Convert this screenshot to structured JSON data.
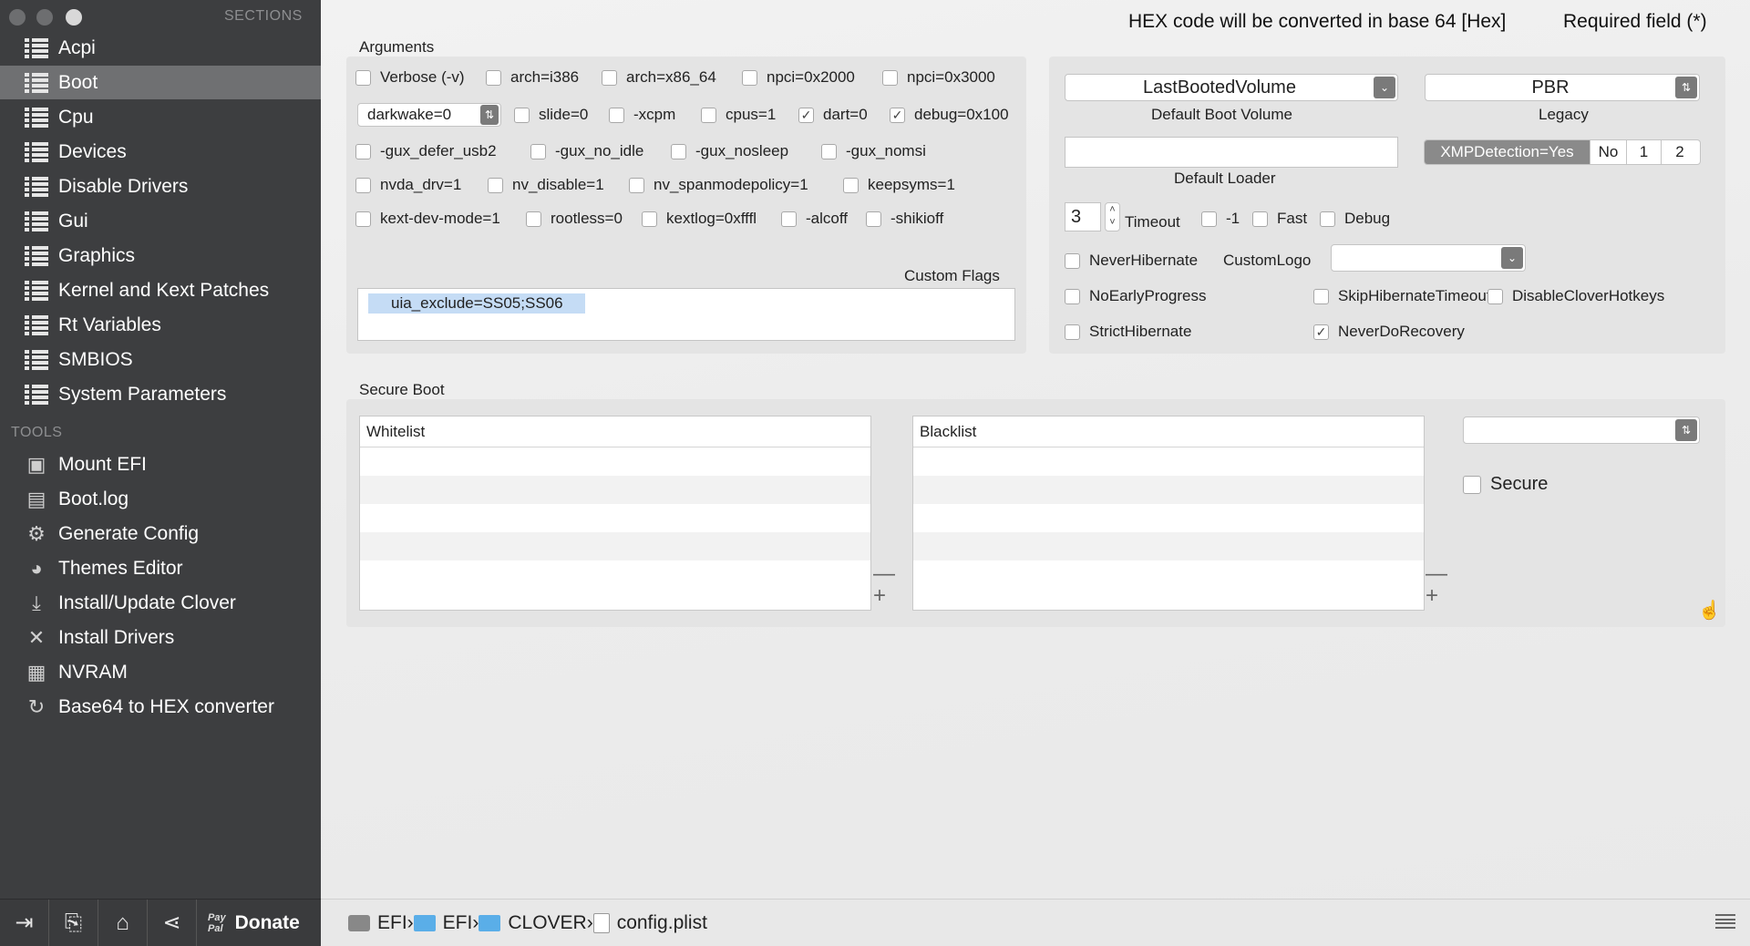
{
  "sidebar": {
    "sections_header": "SECTIONS",
    "tools_header": "TOOLS",
    "sections": [
      {
        "label": "Acpi"
      },
      {
        "label": "Boot"
      },
      {
        "label": "Cpu"
      },
      {
        "label": "Devices"
      },
      {
        "label": "Disable Drivers"
      },
      {
        "label": "Gui"
      },
      {
        "label": "Graphics"
      },
      {
        "label": "Kernel and Kext Patches"
      },
      {
        "label": "Rt Variables"
      },
      {
        "label": "SMBIOS"
      },
      {
        "label": "System Parameters"
      }
    ],
    "selected_section": "Boot",
    "tools": [
      {
        "label": "Mount EFI",
        "icon": "disk-icon"
      },
      {
        "label": "Boot.log",
        "icon": "printer-icon"
      },
      {
        "label": "Generate Config",
        "icon": "gear-icon"
      },
      {
        "label": "Themes Editor",
        "icon": "palette-icon"
      },
      {
        "label": "Install/Update Clover",
        "icon": "download-icon"
      },
      {
        "label": "Install Drivers",
        "icon": "tools-icon"
      },
      {
        "label": "NVRAM",
        "icon": "chip-icon"
      },
      {
        "label": "Base64 to HEX converter",
        "icon": "refresh-icon"
      }
    ],
    "bottom": {
      "donate_label": "Donate",
      "paypal_top": "Pay",
      "paypal_bottom": "Pal"
    }
  },
  "header": {
    "hex_note": "HEX code will be converted in base 64 [Hex]",
    "required_note": "Required field (*)"
  },
  "arguments": {
    "title": "Arguments",
    "row1": [
      {
        "label": "Verbose (-v)",
        "checked": false
      },
      {
        "label": "arch=i386",
        "checked": false
      },
      {
        "label": "arch=x86_64",
        "checked": false
      },
      {
        "label": "npci=0x2000",
        "checked": false
      },
      {
        "label": "npci=0x3000",
        "checked": false
      }
    ],
    "darkwake_value": "darkwake=0",
    "row2": [
      {
        "label": "slide=0",
        "checked": false
      },
      {
        "label": "-xcpm",
        "checked": false
      },
      {
        "label": "cpus=1",
        "checked": false
      },
      {
        "label": "dart=0",
        "checked": true
      },
      {
        "label": "debug=0x100",
        "checked": true
      }
    ],
    "row3": [
      {
        "label": "-gux_defer_usb2",
        "checked": false
      },
      {
        "label": "-gux_no_idle",
        "checked": false
      },
      {
        "label": "-gux_nosleep",
        "checked": false
      },
      {
        "label": "-gux_nomsi",
        "checked": false
      }
    ],
    "row4": [
      {
        "label": "nvda_drv=1",
        "checked": false
      },
      {
        "label": "nv_disable=1",
        "checked": false
      },
      {
        "label": "nv_spanmodepolicy=1",
        "checked": false
      },
      {
        "label": "keepsyms=1",
        "checked": false
      }
    ],
    "row5": [
      {
        "label": "kext-dev-mode=1",
        "checked": false
      },
      {
        "label": "rootless=0",
        "checked": false
      },
      {
        "label": "kextlog=0xfffl",
        "checked": false
      },
      {
        "label": "-alcoff",
        "checked": false
      },
      {
        "label": "-shikioff",
        "checked": false
      }
    ],
    "custom_flags_label": "Custom Flags",
    "custom_flags_value": "uia_exclude=SS05;SS06"
  },
  "boot_options": {
    "default_volume_value": "LastBootedVolume",
    "default_volume_label": "Default Boot Volume",
    "legacy_value": "PBR",
    "legacy_label": "Legacy",
    "default_loader_label": "Default Loader",
    "default_loader_value": "",
    "xmp": [
      {
        "label": "XMPDetection=Yes",
        "selected": true
      },
      {
        "label": "No",
        "selected": false
      },
      {
        "label": "1",
        "selected": false
      },
      {
        "label": "2",
        "selected": false
      }
    ],
    "timeout_value": "3",
    "timeout_label": "Timeout",
    "timeout_flags": [
      {
        "label": "-1",
        "checked": false
      },
      {
        "label": "Fast",
        "checked": false
      },
      {
        "label": "Debug",
        "checked": false
      }
    ],
    "never_hibernate": {
      "label": "NeverHibernate",
      "checked": false
    },
    "custom_logo_label": "CustomLogo",
    "custom_logo_value": "",
    "row_a": [
      {
        "label": "NoEarlyProgress",
        "checked": false
      },
      {
        "label": "SkipHibernateTimeout",
        "checked": false
      },
      {
        "label": "DisableCloverHotkeys",
        "checked": false
      }
    ],
    "row_b": [
      {
        "label": "StrictHibernate",
        "checked": false
      },
      {
        "label": "NeverDoRecovery",
        "checked": true
      }
    ]
  },
  "secure_boot": {
    "title": "Secure Boot",
    "whitelist_header": "Whitelist",
    "blacklist_header": "Blacklist",
    "policy_value": "",
    "secure": {
      "label": "Secure",
      "checked": false
    }
  },
  "statusbar": {
    "path": [
      {
        "label": "EFI",
        "icon": "drive-icon"
      },
      {
        "label": "EFI",
        "icon": "folder-icon"
      },
      {
        "label": "CLOVER",
        "icon": "folder-icon"
      },
      {
        "label": "config.plist",
        "icon": "file-icon"
      }
    ]
  },
  "colors": {
    "sidebar_bg": "#3d3e40",
    "sidebar_selected": "#6f7072",
    "selection_highlight": "#c5dcf5",
    "folder_blue": "#5aaee8"
  }
}
